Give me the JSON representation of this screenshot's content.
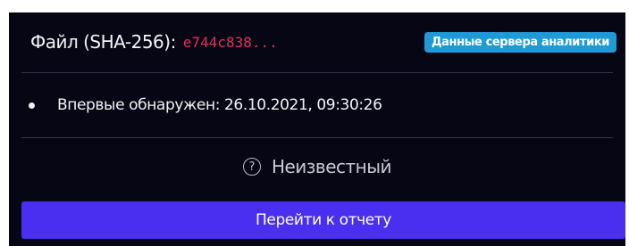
{
  "header": {
    "file_label": "Файл (SHA-256):",
    "hash": "e744c838...",
    "badge": "Данные сервера аналитики"
  },
  "info": {
    "first_seen": "Впервые обнаружен: 26.10.2021, 09:30:26"
  },
  "status": {
    "icon": "question-circle-icon",
    "icon_glyph": "?",
    "label": "Неизвестный"
  },
  "actions": {
    "report_button": "Перейти к отчету"
  },
  "colors": {
    "panel_bg": "#070614",
    "hash": "#e0315f",
    "badge": "#1f9ad6",
    "button": "#4a2ff0"
  }
}
